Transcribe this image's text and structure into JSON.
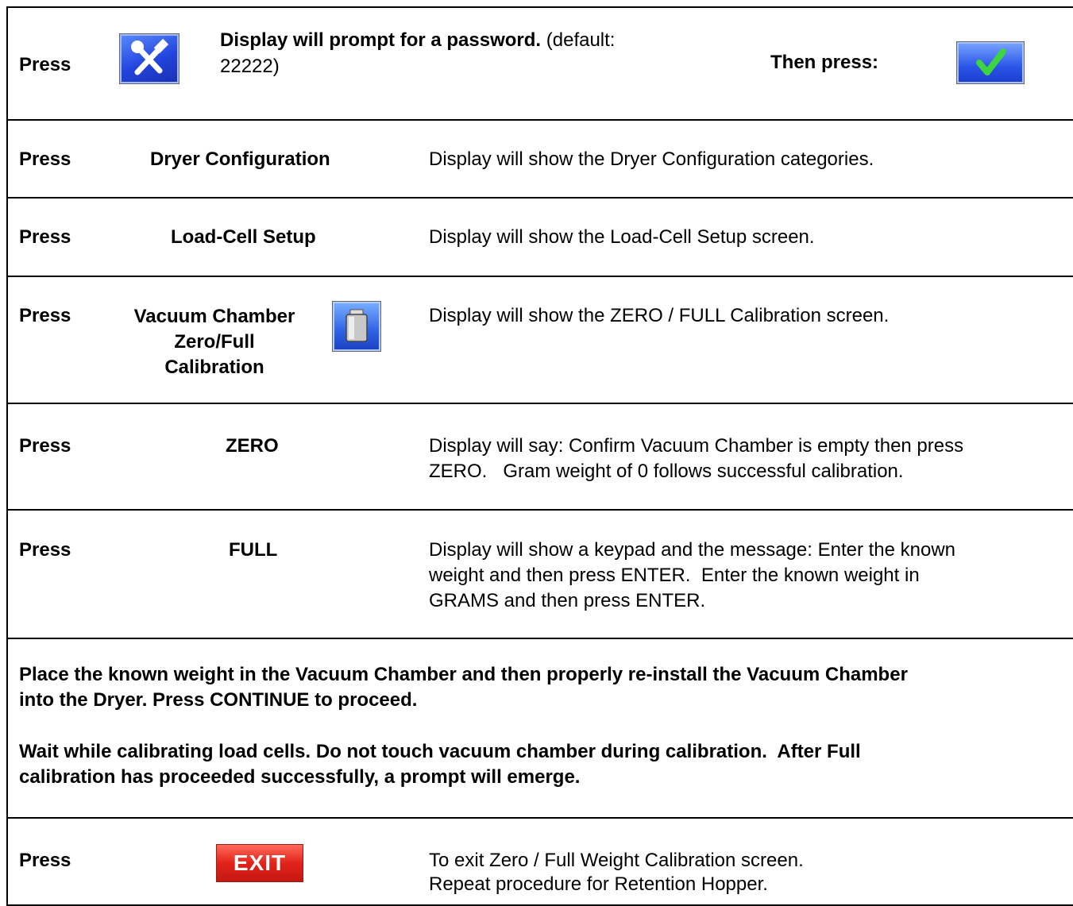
{
  "rows": [
    {
      "press": "Press",
      "title_bold": "Display will prompt for a password.",
      "title_rest": "(default:",
      "title_line2": "22222)",
      "then": "Then press:",
      "left_icon": "tools-icon",
      "right_icon": "checkmark-icon"
    },
    {
      "press": "Press",
      "label": "Dryer Configuration",
      "desc": "Display will show the Dryer Configuration categories."
    },
    {
      "press": "Press",
      "label": "Load-Cell Setup",
      "desc": "Display will show the Load-Cell Setup screen."
    },
    {
      "press": "Press",
      "label_lines": [
        "Vacuum Chamber",
        "Zero/Full",
        "Calibration"
      ],
      "desc": "Display will show the ZERO / FULL Calibration screen.",
      "icon": "weight-icon"
    },
    {
      "press": "Press",
      "label": "ZERO",
      "desc_lines": [
        "Display will say: Confirm Vacuum Chamber is empty then press",
        "ZERO.   Gram weight of 0 follows successful calibration."
      ]
    },
    {
      "press": "Press",
      "label": "FULL",
      "desc_lines": [
        "Display will show a keypad and the message: Enter the known",
        "weight and then press ENTER.  Enter the known weight in",
        "GRAMS and then press ENTER."
      ]
    },
    {
      "para1_lines": [
        "Place the known weight in the Vacuum Chamber and then properly re-install the Vacuum Chamber",
        "into the Dryer. Press CONTINUE to proceed."
      ],
      "para2_lines": [
        "Wait while calibrating load cells. Do not touch vacuum chamber during calibration.  After Full",
        "calibration has proceeded successfully, a prompt will emerge."
      ]
    },
    {
      "press": "Press",
      "button": "EXIT",
      "desc_lines": [
        "To exit Zero / Full Weight Calibration screen.",
        "Repeat procedure for Retention Hopper."
      ]
    }
  ]
}
